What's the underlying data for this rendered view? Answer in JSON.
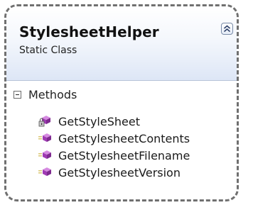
{
  "class_shape": {
    "name": "StylesheetHelper",
    "kind": "Static Class",
    "collapse_icon": "double-chevron-up-icon",
    "compartments": [
      {
        "label": "Methods",
        "expander_icon": "minus-box-icon",
        "members": [
          {
            "label": "GetStyleSheet",
            "icon": "method-icon-with-lock",
            "visibility": "private"
          },
          {
            "label": "GetStylesheetContents",
            "icon": "public-method-icon",
            "visibility": "public"
          },
          {
            "label": "GetStylesheetFilename",
            "icon": "public-method-icon",
            "visibility": "public"
          },
          {
            "label": "GetStylesheetVersion",
            "icon": "public-method-icon",
            "visibility": "public"
          }
        ]
      }
    ]
  },
  "colors": {
    "border": "#707070",
    "header_gradient_end": "#dde6f6",
    "method_icon": "#b04fc0"
  }
}
